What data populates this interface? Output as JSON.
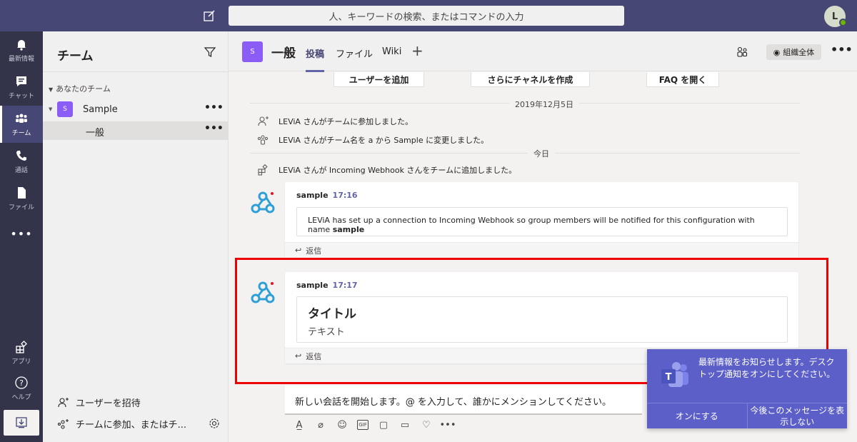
{
  "topbar": {
    "search_placeholder": "人、キーワードの検索、またはコマンドの入力",
    "avatar_initial": "L"
  },
  "rail": {
    "items": [
      {
        "label": "最新情報",
        "icon": "bell-icon"
      },
      {
        "label": "チャット",
        "icon": "chat-icon"
      },
      {
        "label": "チーム",
        "icon": "teams-icon",
        "active": true
      },
      {
        "label": "通話",
        "icon": "phone-icon"
      },
      {
        "label": "ファイル",
        "icon": "file-icon"
      }
    ],
    "more": "•••",
    "apps_label": "アプリ",
    "help_label": "ヘルプ"
  },
  "panel": {
    "title": "チーム",
    "section_label": "あなたのチーム",
    "team": {
      "initial": "S",
      "name": "Sample"
    },
    "channel": {
      "name": "一般"
    },
    "more": "•••",
    "invite_label": "ユーザーを招待",
    "join_label": "チームに参加、またはチ..."
  },
  "channel_header": {
    "initial": "S",
    "title": "一般",
    "tabs": [
      "投稿",
      "ファイル",
      "Wiki"
    ],
    "active_tab": "投稿",
    "plus": "+",
    "org_button": "組織全体",
    "more": "•••"
  },
  "conversation": {
    "quick_actions": [
      "ユーザーを追加",
      "さらにチャネルを作成",
      "FAQ を開く"
    ],
    "date1": "2019年12月5日",
    "sys1": "LEViA さんがチームに参加しました。",
    "sys2": "LEViA さんがチーム名を a から Sample に変更しました。",
    "date2": "今日",
    "sys3": "LEViA さんが Incoming Webhook さんをチームに追加しました。",
    "msg1": {
      "author": "sample",
      "time": "17:16",
      "text_pre": "LEViA has set up a connection to Incoming Webhook so group members will be notified for this configuration with name ",
      "text_bold": "sample",
      "reply": "返信"
    },
    "msg2": {
      "author": "sample",
      "time": "17:17",
      "title": "タイトル",
      "text": "テキスト",
      "reply": "返信"
    },
    "compose_placeholder": "新しい会話を開始します。@ を入力して、誰かにメンションしてください。",
    "tools": {
      "gif": "GIF",
      "more": "•••"
    }
  },
  "toast": {
    "message": "最新情報をお知らせします。デスクトップ通知をオンにしてください。",
    "turn_on": "オンにする",
    "dont_show": "今後このメッセージを表示しない"
  },
  "colors": {
    "topbar": "#464775",
    "rail": "#33344a",
    "accent": "#6264a7",
    "team_tile": "#8b5cf6",
    "highlight": "#e00000",
    "toast": "#5b5fc7"
  }
}
